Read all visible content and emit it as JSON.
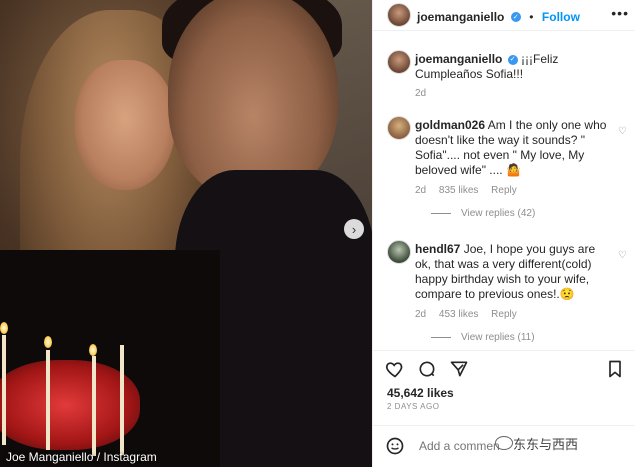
{
  "photo": {
    "credit": "Joe Manganiello / Instagram",
    "next_icon": "chevron-right-icon"
  },
  "header": {
    "username": "joemanganiello",
    "dot": "•",
    "follow_label": "Follow",
    "more_icon": "more-horizontal-icon"
  },
  "caption": {
    "username": "joemanganiello",
    "text": "¡¡¡Feliz Cumpleaños Sofia!!!",
    "age": "2d"
  },
  "comments": [
    {
      "username": "goldman026",
      "text": "Am I the only one who doesn't like the way it sounds? \" Sofia\".... not even \" My love, My beloved wife\" .... 🤷",
      "age": "2d",
      "likes": "835 likes",
      "reply_label": "Reply",
      "view_replies": "View replies (42)"
    },
    {
      "username": "hendl67",
      "text": "Joe, I hope you guys are ok, that was a very different(cold) happy birthday wish to your wife, compare to previous ones!.😟",
      "age": "2d",
      "likes": "453 likes",
      "reply_label": "Reply",
      "view_replies": "View replies (11)"
    }
  ],
  "actions": {
    "likes": "45,642 likes",
    "date": "2 DAYS AGO",
    "add_comment_placeholder": "Add a comment...",
    "watermark": "东东与西西"
  },
  "colors": {
    "accent": "#0095f6",
    "verified": "#3897f0",
    "muted": "#8e8e8e"
  }
}
